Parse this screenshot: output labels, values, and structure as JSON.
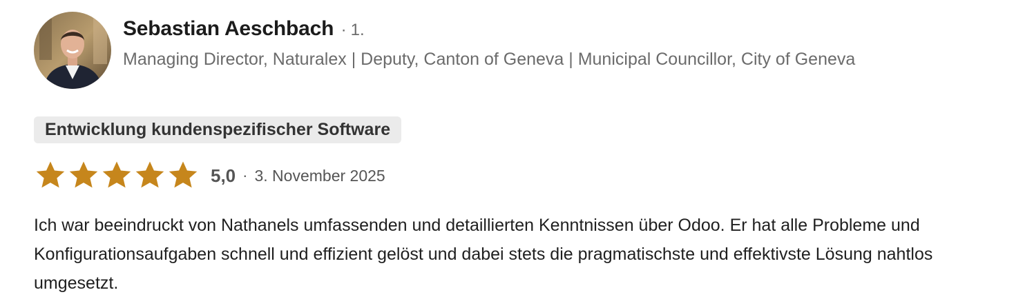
{
  "reviewer": {
    "name": "Sebastian Aeschbach",
    "degree_separator": "·",
    "degree": "1.",
    "headline": "Managing Director, Naturalex | Deputy, Canton of Geneva | Municipal Councillor, City of Geneva",
    "avatar_icon": "person-photo"
  },
  "service_tag": "Entwicklung kundenspezifischer Software",
  "rating": {
    "stars_filled": 5,
    "stars_total": 5,
    "star_color": "#c6861c",
    "score": "5,0",
    "separator": "·",
    "date": "3. November 2025"
  },
  "review_text": "Ich war beeindruckt von Nathanels umfassenden und detaillierten Kenntnissen über Odoo. Er hat alle Probleme und Konfigurationsaufgaben schnell und effizient gelöst und dabei stets die pragmatischste und effektivste Lösung nahtlos umgesetzt."
}
